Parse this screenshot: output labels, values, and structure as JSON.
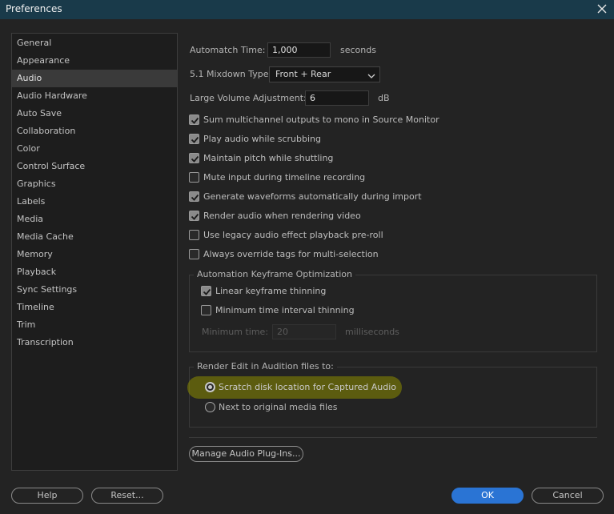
{
  "window": {
    "title": "Preferences"
  },
  "sidebar": {
    "items": [
      {
        "label": "General"
      },
      {
        "label": "Appearance"
      },
      {
        "label": "Audio",
        "selected": true
      },
      {
        "label": "Audio Hardware"
      },
      {
        "label": "Auto Save"
      },
      {
        "label": "Collaboration"
      },
      {
        "label": "Color"
      },
      {
        "label": "Control Surface"
      },
      {
        "label": "Graphics"
      },
      {
        "label": "Labels"
      },
      {
        "label": "Media"
      },
      {
        "label": "Media Cache"
      },
      {
        "label": "Memory"
      },
      {
        "label": "Playback"
      },
      {
        "label": "Sync Settings"
      },
      {
        "label": "Timeline"
      },
      {
        "label": "Trim"
      },
      {
        "label": "Transcription"
      }
    ]
  },
  "audio": {
    "automatch": {
      "label": "Automatch Time:",
      "value": "1,000",
      "unit": "seconds"
    },
    "mixdown": {
      "label": "5.1 Mixdown Type:",
      "value": "Front + Rear"
    },
    "large_volume": {
      "label": "Large Volume Adjustment:",
      "value": "6",
      "unit": "dB"
    },
    "checkboxes": [
      {
        "label": "Sum multichannel outputs to mono in Source Monitor",
        "checked": true
      },
      {
        "label": "Play audio while scrubbing",
        "checked": true
      },
      {
        "label": "Maintain pitch while shuttling",
        "checked": true
      },
      {
        "label": "Mute input during timeline recording",
        "checked": false
      },
      {
        "label": "Generate waveforms automatically during import",
        "checked": true
      },
      {
        "label": "Render audio when rendering video",
        "checked": true
      },
      {
        "label": "Use legacy audio effect playback pre-roll",
        "checked": false
      },
      {
        "label": "Always override tags for multi-selection",
        "checked": false
      }
    ],
    "keyframe_group": {
      "title": "Automation Keyframe Optimization",
      "linear": {
        "label": "Linear keyframe thinning",
        "checked": true
      },
      "min_interval": {
        "label": "Minimum time interval thinning",
        "checked": false
      },
      "min_time": {
        "label": "Minimum time:",
        "value": "20",
        "unit": "milliseconds"
      }
    },
    "render_group": {
      "title": "Render Edit in Audition files to:",
      "options": [
        {
          "label": "Scratch disk location for Captured Audio",
          "selected": true
        },
        {
          "label": "Next to original media files",
          "selected": false
        }
      ]
    },
    "plugins_button": "Manage Audio Plug-Ins..."
  },
  "footer": {
    "help": "Help",
    "reset": "Reset...",
    "ok": "OK",
    "cancel": "Cancel"
  },
  "colors": {
    "titlebar": "#193a4a",
    "highlight": "#8c8c00",
    "primary": "#2a74d4"
  }
}
